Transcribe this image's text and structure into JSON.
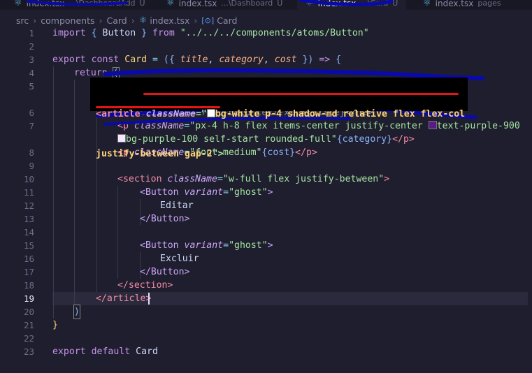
{
  "tabs": [
    {
      "file": "index.tsx",
      "path": "...\\DashboardAdd",
      "badge": "U"
    },
    {
      "file": "index.tsx",
      "path": "...\\Dashboard",
      "badge": "U"
    },
    {
      "file": "index.tsx",
      "path": "...\\Card",
      "badge": "U",
      "active": true
    },
    {
      "file": "index.tsx",
      "path": "pages",
      "badge": ""
    }
  ],
  "breadcrumb": {
    "p1": "src",
    "p2": "components",
    "p3": "Card",
    "p4": "index.tsx",
    "p5": "Card"
  },
  "line_numbers": [
    "1",
    "2",
    "3",
    "4",
    "5",
    "6",
    "7",
    "8",
    "9",
    "10",
    "11",
    "12",
    "13",
    "14",
    "15",
    "16",
    "17",
    "18",
    "19",
    "20",
    "21",
    "22",
    "23"
  ],
  "code": {
    "l1_import": "import",
    "l1_brace_open": "{",
    "l1_button": "Button",
    "l1_brace_close": "}",
    "l1_from": "from",
    "l1_path": "\"../../../components/atoms/Button\"",
    "l3_export": "export",
    "l3_const": "const",
    "l3_card": "Card",
    "l3_eq": "=",
    "l3_open": "({",
    "l3_title": "title",
    "l3_comma1": ",",
    "l3_category": "category",
    "l3_comma2": ",",
    "l3_cost": "cost",
    "l3_close": "})",
    "l3_arrow": "=>",
    "l3_brace": "{",
    "l4_return": "return",
    "l4_paren": "(",
    "l5_tag": "<article",
    "l5_attr": "className",
    "l5_eq": "=\"",
    "l5_value": "bg-white p-4 shadow-md relative flex flex-col",
    "l5b_value": "justify-between gap-2",
    "l5b_end": "\">",
    "l6_partial": "<h2 className=\"font-bold text-xl\">{title}</h2>",
    "l7_tag": "<p",
    "l7_attr": "className",
    "l7_eq": "=\"",
    "l7_value": "px-4 h-8 flex items-center justify-center",
    "l7_value2": "text-purple-900",
    "l7b_value": "bg-purple-100 self-start rounded-full\"",
    "l7b_expr": "{category}",
    "l7b_close": "</p>",
    "l8_tag": "<p",
    "l8_attr": "className",
    "l8_eq": "=",
    "l8_value": "\"font-medium\"",
    "l8_expr": "{cost}",
    "l8_close": "</p>",
    "l10_tag": "<section",
    "l10_attr": "className",
    "l10_eq": "=",
    "l10_value": "\"w-full flex justify-between\"",
    "l10_end": ">",
    "l11_tag": "<Button",
    "l11_attr": "variant",
    "l11_eq": "=",
    "l11_value": "\"ghost\"",
    "l11_end": ">",
    "l12_text": "Editar",
    "l13_close": "</Button>",
    "l15_tag": "<Button",
    "l15_attr": "variant",
    "l15_eq": "=",
    "l15_value": "\"ghost\"",
    "l15_end": ">",
    "l16_text": "Excluir",
    "l17_close": "</Button>",
    "l18_close": "</section>",
    "l19_close": "</article>",
    "l20_paren": ")",
    "l21_brace": "}",
    "l23_export": "export",
    "l23_default": "default",
    "l23_card": "Card"
  },
  "colors": {
    "bg": "#1e1e2e",
    "highlight_box": "#000000",
    "underline": "#e31515",
    "scribble": "#0a0aa8"
  },
  "icons": {
    "tab": "react-icon",
    "symbol": "symbol-icon"
  }
}
